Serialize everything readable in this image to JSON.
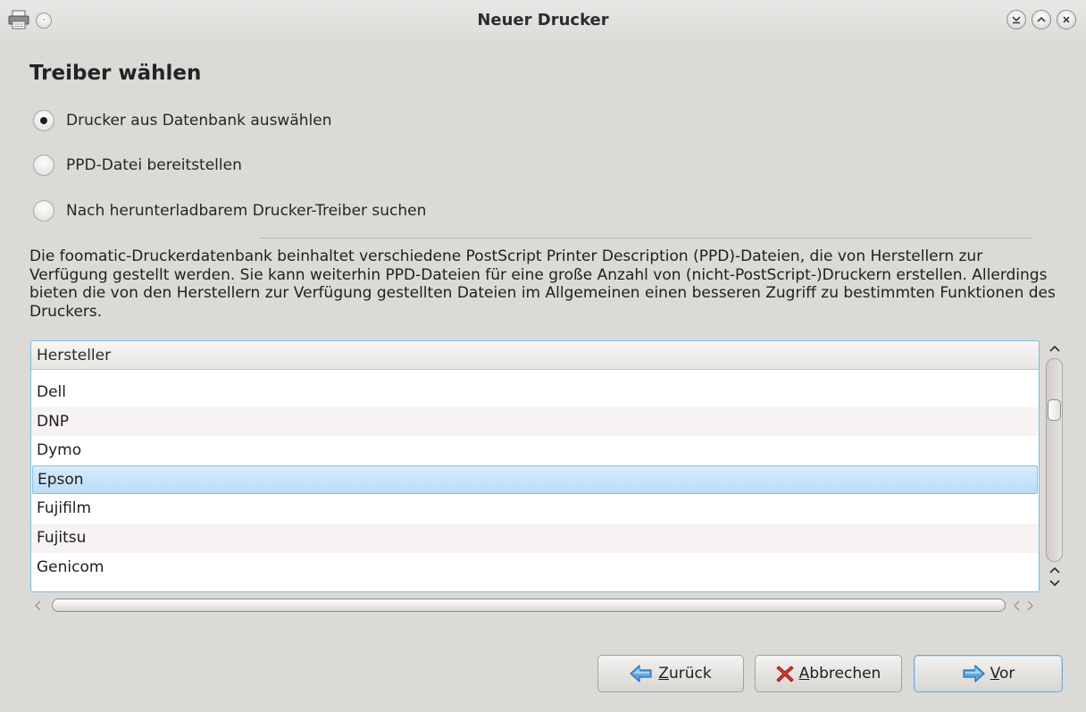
{
  "window": {
    "title": "Neuer Drucker"
  },
  "page": {
    "heading": "Treiber wählen",
    "options": [
      {
        "label": "Drucker aus Datenbank auswählen",
        "selected": true
      },
      {
        "label": "PPD-Datei bereitstellen",
        "selected": false
      },
      {
        "label": "Nach herunterladbarem Drucker-Treiber suchen",
        "selected": false
      }
    ],
    "description": "Die foomatic-Druckerdatenbank beinhaltet verschiedene PostScript Printer Description (PPD)-Dateien, die von Herstellern zur Verfügung gestellt werden. Sie kann weiterhin PPD-Dateien für eine große Anzahl von (nicht-PostScript-)Druckern erstellen. Allerdings bieten die von den Herstellern zur Verfügung gestellten Dateien im Allgemeinen einen besseren Zugriff zu bestimmten Funktionen des Druckers."
  },
  "manufacturer_list": {
    "header": "Hersteller",
    "items": [
      "Dell",
      "DNP",
      "Dymo",
      "Epson",
      "Fujifilm",
      "Fujitsu",
      "Genicom"
    ],
    "selected": "Epson"
  },
  "buttons": {
    "back": {
      "mnemonic": "Z",
      "rest": "urück"
    },
    "cancel": {
      "mnemonic": "A",
      "rest": "bbrechen"
    },
    "forward": {
      "mnemonic": "V",
      "rest": "or"
    }
  },
  "colors": {
    "selection": "#c6e2f7",
    "selection_border": "#87bde6",
    "focus_border": "#7fb9e0",
    "arrow_blue": "#4a9ee0",
    "cancel_red": "#d9342b"
  }
}
